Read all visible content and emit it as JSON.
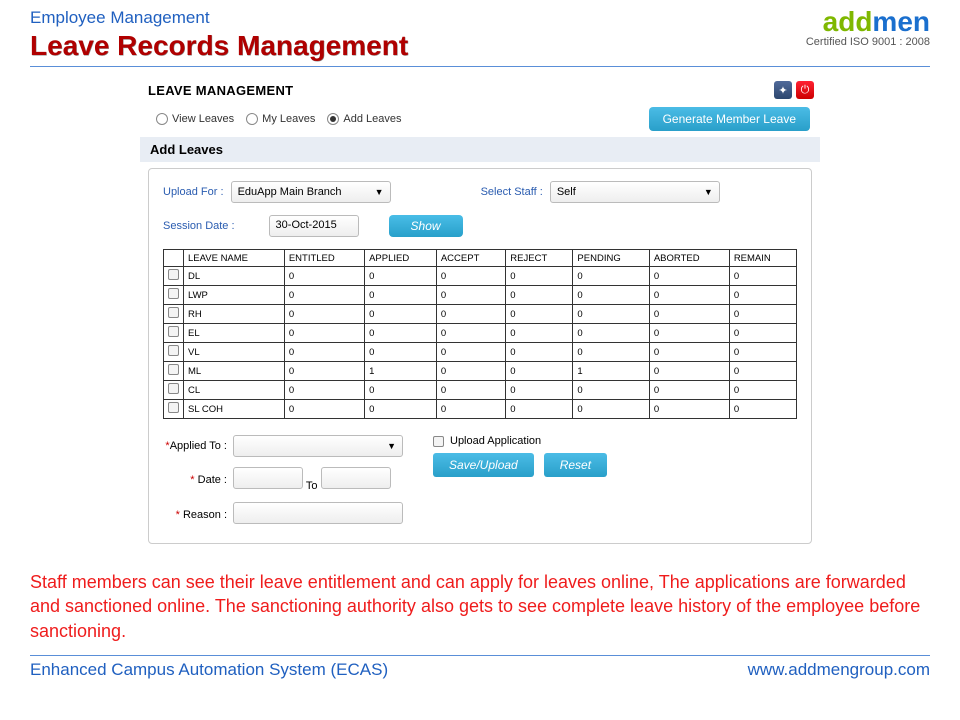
{
  "header": {
    "breadcrumb": "Employee Management",
    "title": "Leave Records Management",
    "logo_text_a": "add",
    "logo_text_b": "men",
    "cert": "Certified ISO 9001 : 2008"
  },
  "panel": {
    "title": "LEAVE MANAGEMENT",
    "radios": {
      "view": "View Leaves",
      "my": "My Leaves",
      "add": "Add Leaves"
    },
    "generate_btn": "Generate Member Leave",
    "section": "Add Leaves",
    "upload_for_label": "Upload For :",
    "upload_for_value": "EduApp Main Branch",
    "select_staff_label": "Select Staff :",
    "select_staff_value": "Self",
    "session_date_label": "Session Date :",
    "session_date_value": "30-Oct-2015",
    "show_btn": "Show",
    "table": {
      "headers": [
        "LEAVE NAME",
        "ENTITLED",
        "APPLIED",
        "ACCEPT",
        "REJECT",
        "PENDING",
        "ABORTED",
        "REMAIN"
      ],
      "rows": [
        {
          "name": "DL",
          "entitled": "0",
          "applied": "0",
          "accept": "0",
          "reject": "0",
          "pending": "0",
          "aborted": "0",
          "remain": "0"
        },
        {
          "name": "LWP",
          "entitled": "0",
          "applied": "0",
          "accept": "0",
          "reject": "0",
          "pending": "0",
          "aborted": "0",
          "remain": "0"
        },
        {
          "name": "RH",
          "entitled": "0",
          "applied": "0",
          "accept": "0",
          "reject": "0",
          "pending": "0",
          "aborted": "0",
          "remain": "0"
        },
        {
          "name": "EL",
          "entitled": "0",
          "applied": "0",
          "accept": "0",
          "reject": "0",
          "pending": "0",
          "aborted": "0",
          "remain": "0"
        },
        {
          "name": "VL",
          "entitled": "0",
          "applied": "0",
          "accept": "0",
          "reject": "0",
          "pending": "0",
          "aborted": "0",
          "remain": "0"
        },
        {
          "name": "ML",
          "entitled": "0",
          "applied": "1",
          "accept": "0",
          "reject": "0",
          "pending": "1",
          "aborted": "0",
          "remain": "0"
        },
        {
          "name": "CL",
          "entitled": "0",
          "applied": "0",
          "accept": "0",
          "reject": "0",
          "pending": "0",
          "aborted": "0",
          "remain": "0"
        },
        {
          "name": "SL COH",
          "entitled": "0",
          "applied": "0",
          "accept": "0",
          "reject": "0",
          "pending": "0",
          "aborted": "0",
          "remain": "0"
        }
      ]
    },
    "applied_to_label": "Applied To :",
    "date_label": "Date :",
    "date_to": "To",
    "reason_label": "Reason :",
    "upload_app_label": "Upload Application",
    "save_btn": "Save/Upload",
    "reset_btn": "Reset"
  },
  "description": "Staff members can see their leave entitlement and can apply for leaves online, The applications are forwarded and sanctioned online. The sanctioning authority also gets to see complete leave history of the employee before sanctioning.",
  "footer": {
    "left": "Enhanced Campus Automation System (ECAS)",
    "right": "www.addmengroup.com"
  }
}
